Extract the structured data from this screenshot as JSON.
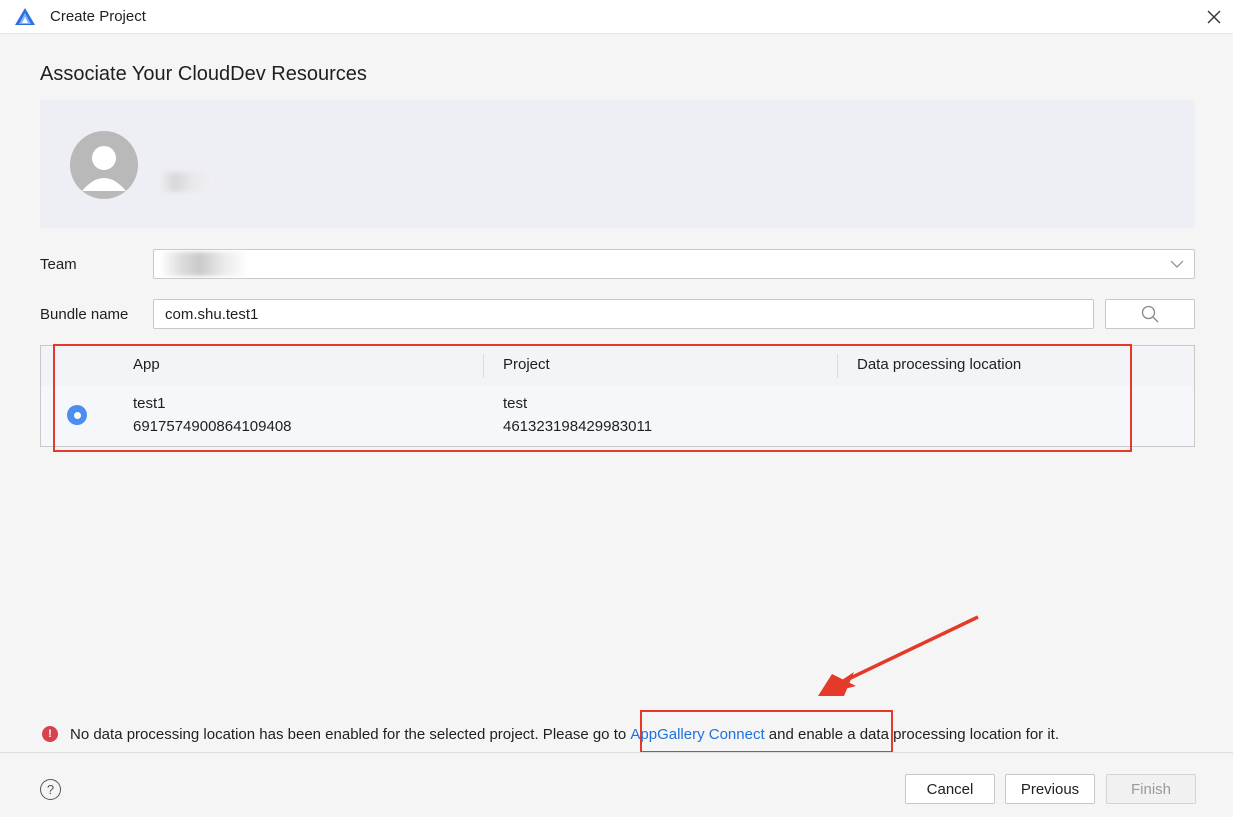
{
  "window": {
    "title": "Create Project",
    "logo_icon": "deveco-logo-icon",
    "close_icon": "close-icon"
  },
  "page": {
    "title": "Associate Your CloudDev Resources"
  },
  "account": {
    "avatar_icon": "user-avatar-icon"
  },
  "form": {
    "team_label": "Team",
    "team_value": "",
    "bundle_label": "Bundle name",
    "bundle_value": "com.shu.test1",
    "search_icon": "search-icon"
  },
  "table": {
    "columns": [
      "App",
      "Project",
      "Data processing location"
    ],
    "rows": [
      {
        "selected": true,
        "app_name": "test1",
        "app_id": "6917574900864109408",
        "project_name": "test",
        "project_id": "461323198429983011",
        "location": ""
      }
    ]
  },
  "warning": {
    "icon": "error-icon",
    "text_before": "No data processing location has been enabled for the selected project. Please go to",
    "link_text": "AppGallery Connect",
    "text_after": "and enable a data processing location for it."
  },
  "footer": {
    "help_label": "?",
    "cancel_label": "Cancel",
    "previous_label": "Previous",
    "finish_label": "Finish"
  },
  "colors": {
    "accent": "#4c8ef0",
    "link": "#1e72e0",
    "annotation": "#e5392a",
    "error": "#d7424f"
  }
}
